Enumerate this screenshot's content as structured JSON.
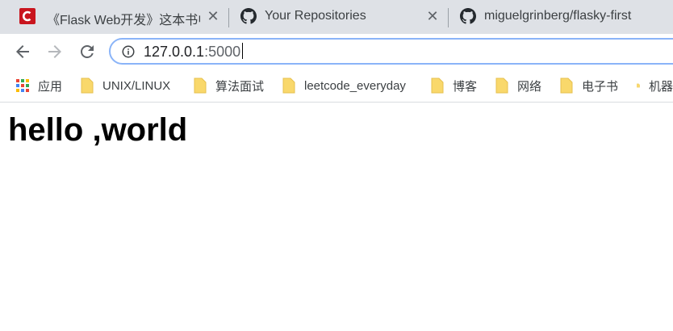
{
  "tabs": [
    {
      "title": "《Flask Web开发》这本书中",
      "favicon": "csdn-icon",
      "close": "✕"
    },
    {
      "title": "Your Repositories",
      "favicon": "github-icon",
      "close": "✕"
    },
    {
      "title": "miguelgrinberg/flasky-first",
      "favicon": "github-icon",
      "close": ""
    }
  ],
  "toolbar": {
    "back": "back-arrow-icon",
    "forward": "forward-arrow-icon",
    "reload": "reload-icon",
    "url_host": "127.0.0.1",
    "url_port": ":5000",
    "security": "info-icon"
  },
  "bookmarks": [
    {
      "label": "应用",
      "icon": "apps-grid-icon"
    },
    {
      "label": "UNIX/LINUX",
      "icon": "folder-icon"
    },
    {
      "label": "算法面试",
      "icon": "folder-icon"
    },
    {
      "label": "leetcode_everyday",
      "icon": "folder-icon"
    },
    {
      "label": "博客",
      "icon": "folder-icon"
    },
    {
      "label": "网络",
      "icon": "folder-icon"
    },
    {
      "label": "电子书",
      "icon": "folder-icon"
    },
    {
      "label": "机器",
      "icon": "folder-icon"
    }
  ],
  "page": {
    "heading": "hello ,world"
  },
  "colors": {
    "tabstrip": "#dee1e6",
    "folder": "#f9d86b",
    "csdn": "#c9151e",
    "focus": "#8ab4f8"
  }
}
